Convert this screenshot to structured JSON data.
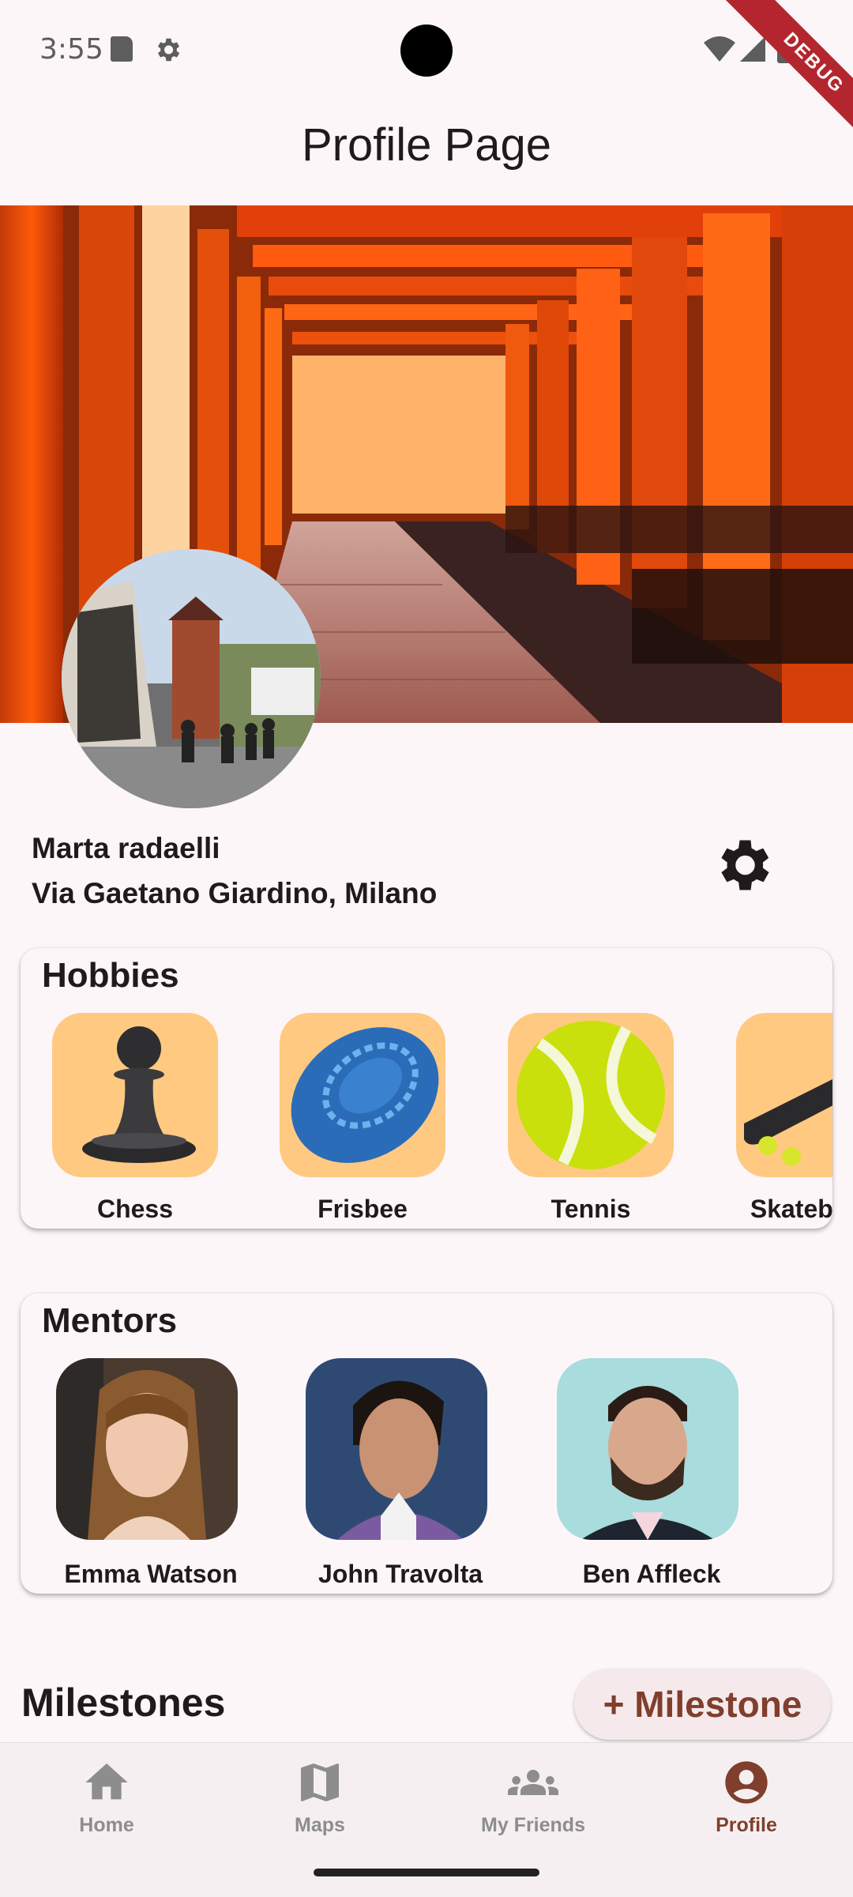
{
  "status_bar": {
    "time": "3:55"
  },
  "debug_banner": "DEBUG",
  "app_bar": {
    "title": "Profile Page"
  },
  "profile": {
    "name": "Marta radaelli",
    "address": "Via Gaetano Giardino, Milano"
  },
  "hobbies": {
    "title": "Hobbies",
    "items": [
      {
        "label": "Chess",
        "icon": "chess-pawn-icon"
      },
      {
        "label": "Frisbee",
        "icon": "frisbee-icon"
      },
      {
        "label": "Tennis",
        "icon": "tennis-ball-icon"
      },
      {
        "label": "Skateboard",
        "icon": "skateboard-icon"
      }
    ]
  },
  "mentors": {
    "title": "Mentors",
    "items": [
      {
        "name": "Emma Watson"
      },
      {
        "name": "John Travolta"
      },
      {
        "name": "Ben Affleck"
      }
    ]
  },
  "milestones": {
    "title": "Milestones",
    "add_button": "+ Milestone"
  },
  "bottom_nav": {
    "items": [
      {
        "label": "Home",
        "icon": "home-icon",
        "active": false
      },
      {
        "label": "Maps",
        "icon": "map-icon",
        "active": false
      },
      {
        "label": "My Friends",
        "icon": "people-icon",
        "active": false
      },
      {
        "label": "Profile",
        "icon": "account-circle-icon",
        "active": true
      }
    ]
  },
  "colors": {
    "background": "#fcf6f9",
    "accent": "#7f3f2c",
    "hobby_tile": "#ffc982",
    "nav_inactive": "#8d8d8d"
  }
}
